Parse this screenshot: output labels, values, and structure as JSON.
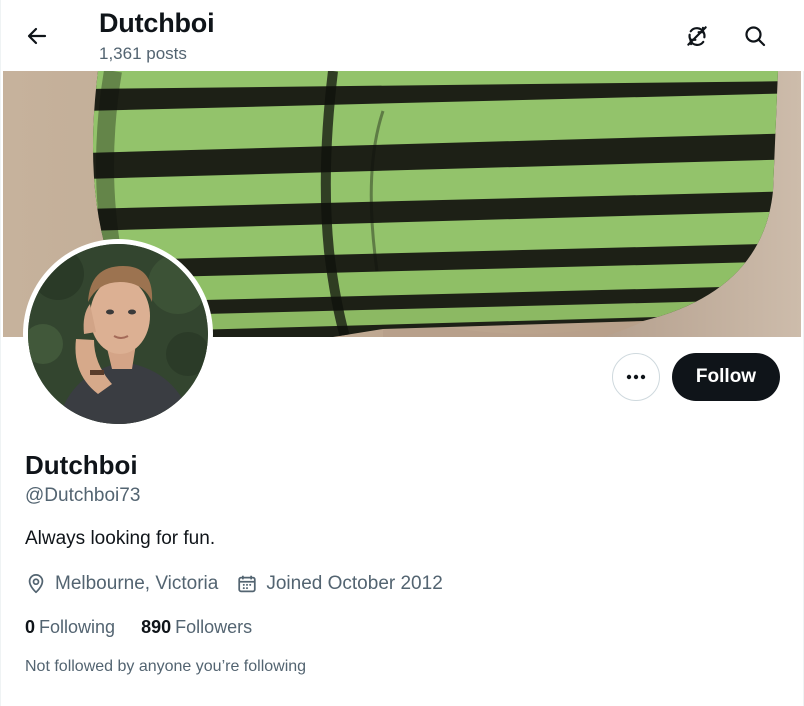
{
  "header": {
    "title": "Dutchboi",
    "posts_count": "1,361 posts",
    "back_icon": "arrow-left-icon",
    "refresh_icon": "no-sync-icon",
    "search_icon": "search-icon"
  },
  "banner": {
    "description_icon": "banner-photo"
  },
  "profile": {
    "display_name": "Dutchboi",
    "handle": "@Dutchboi73",
    "bio": "Always looking for fun.",
    "location": "Melbourne, Victoria",
    "joined": "Joined October 2012",
    "following_count": "0",
    "following_label": "Following",
    "followers_count": "890",
    "followers_label": "Followers",
    "followed_note": "Not followed by anyone you’re following"
  },
  "actions": {
    "more_label": "···",
    "follow_label": "Follow"
  },
  "colors": {
    "text_primary": "#0f1419",
    "text_secondary": "#536471",
    "border": "#cfd9de",
    "stripe_green": "#93c36b",
    "stripe_dark": "#1d2016"
  }
}
